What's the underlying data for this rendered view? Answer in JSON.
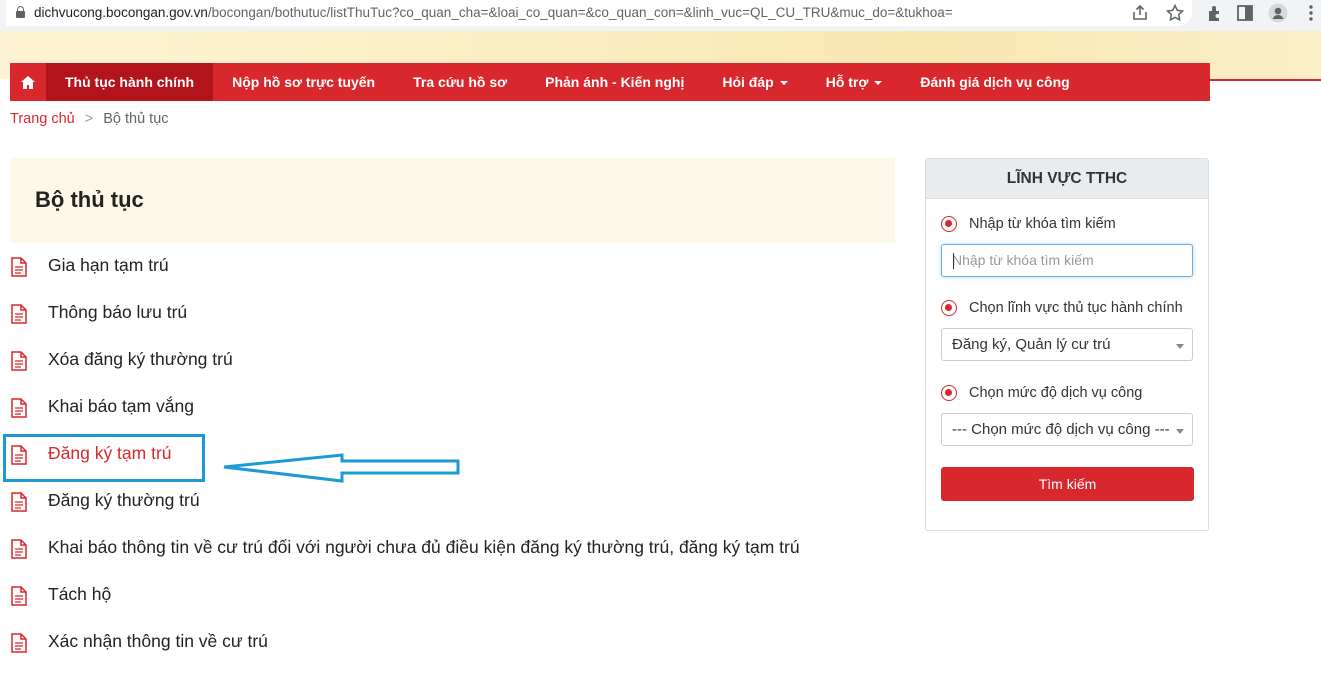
{
  "browser": {
    "url_host": "dichvucong.bocongan.gov.vn",
    "url_path": "/bocongan/bothutuc/listThuTuc?co_quan_cha=&loai_co_quan=&co_quan_con=&linh_vuc=QL_CU_TRU&muc_do=&tukhoa="
  },
  "nav": {
    "items": [
      {
        "label": "Thủ tục hành chính",
        "active": true
      },
      {
        "label": "Nộp hồ sơ trực tuyến"
      },
      {
        "label": "Tra cứu hồ sơ"
      },
      {
        "label": "Phản ánh - Kiến nghị"
      },
      {
        "label": "Hỏi đáp",
        "dropdown": true
      },
      {
        "label": "Hỗ trợ",
        "dropdown": true
      },
      {
        "label": "Đánh giá dịch vụ công"
      }
    ]
  },
  "breadcrumb": {
    "home": "Trang chủ",
    "separator": ">",
    "current": "Bộ thủ tục"
  },
  "page_title": "Bộ thủ tục",
  "procedures": [
    "Gia hạn tạm trú",
    "Thông báo lưu trú",
    "Xóa đăng ký thường trú",
    "Khai báo tạm vắng",
    "Đăng ký tạm trú",
    "Đăng ký thường trú",
    "Khai báo thông tin về cư trú đối với người chưa đủ điều kiện đăng ký thường trú, đăng ký tạm trú",
    "Tách hộ",
    "Xác nhận thông tin về cư trú"
  ],
  "highlighted_procedure": "Đăng ký tạm trú",
  "sidebar": {
    "title": "LĨNH VỰC TTHC",
    "keyword_label": "Nhập từ khóa tìm kiếm",
    "keyword_placeholder": "Nhập từ khóa tìm kiếm",
    "field_label": "Chọn lĩnh vực thủ tục hành chính",
    "field_value": "Đăng ký, Quản lý cư trú",
    "level_label": "Chọn mức độ dịch vụ công",
    "level_value": "--- Chọn mức độ dịch vụ công ---",
    "search_button": "Tìm kiếm"
  },
  "colors": {
    "brand_red": "#d9272e",
    "annotation_blue": "#1c9ad6"
  }
}
